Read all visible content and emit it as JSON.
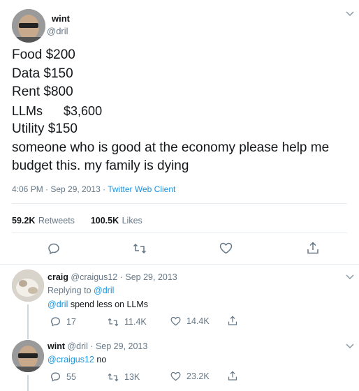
{
  "main_tweet": {
    "author_name": "wint",
    "author_handle": "@dril",
    "lines": [
      "Food $200",
      "Data $150",
      "Rent $800",
      "LLMs      $3,600",
      "Utility $150",
      "someone who is good at the economy please help me",
      "budget this. my family is dying"
    ],
    "timestamp": "4:06 PM · Sep 29, 2013",
    "separator": "·",
    "client": "Twitter Web Client",
    "retweets_count": "59.2K",
    "retweets_label": "Retweets",
    "likes_count": "100.5K",
    "likes_label": "Likes"
  },
  "reply1": {
    "author_name": "craig",
    "author_handle": "@craigus12",
    "date": "· Sep 29, 2013",
    "replying_to_label": "Replying to",
    "replying_to_handle": "@dril",
    "mention": "@dril",
    "text": " spend less on LLMs",
    "reply_count": "17",
    "retweet_count": "11.4K",
    "like_count": "14.4K"
  },
  "reply2": {
    "author_name": "wint",
    "author_handle": "@dril",
    "date": "· Sep 29, 2013",
    "mention": "@craigus12",
    "text": " no",
    "reply_count": "55",
    "retweet_count": "13K",
    "like_count": "23.2K"
  },
  "colors": {
    "link": "#1b95e0",
    "secondary_text": "#657786",
    "divider": "#e6ecf0"
  },
  "icons": [
    "chevron-down-icon",
    "reply-icon",
    "retweet-icon",
    "like-icon",
    "share-icon"
  ]
}
